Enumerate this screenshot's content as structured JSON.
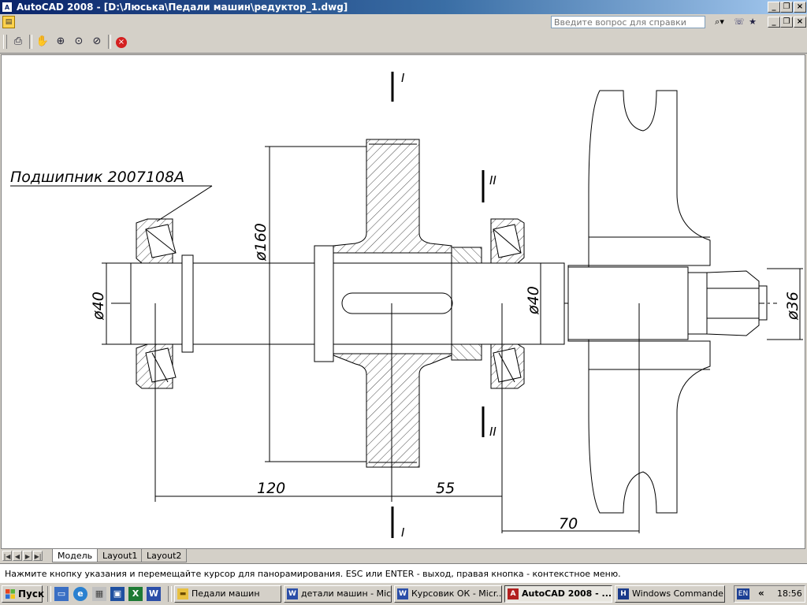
{
  "titlebar": {
    "app_title": "AutoCAD 2008 - [D:\\Люська\\Педали машин\\редуктор_1.dwg]",
    "app_icon": "autocad-icon"
  },
  "menubar": {
    "help_placeholder": "Введите вопрос для справки"
  },
  "toolbar": {
    "icons": [
      "print-icon",
      "pan-realtime-icon",
      "zoom-realtime-icon",
      "zoom-window-icon",
      "zoom-previous-icon",
      "close-icon"
    ]
  },
  "drawing": {
    "bearing_label": "Подшипник 2007108А",
    "section_marks": [
      "I",
      "II",
      "II",
      "I"
    ],
    "dimensions": {
      "d160": "ø160",
      "d40_left": "ø40",
      "d40_mid": "ø40",
      "d36": "ø36",
      "len120": "120",
      "len55": "55",
      "len70": "70"
    }
  },
  "layout_tabs": {
    "tabs": [
      "Модель",
      "Layout1",
      "Layout2"
    ],
    "active": "Модель"
  },
  "command_line": {
    "text": "Нажмите кнопку указания и перемещайте курсор для панорамирования. ESC или ENTER - выход, правая кнопка - контекстное меню."
  },
  "taskbar": {
    "start_label": "Пуск",
    "tasks": [
      {
        "label": "Педали машин",
        "icon": "folder-icon"
      },
      {
        "label": "детали машин - Mic...",
        "icon": "word-icon"
      },
      {
        "label": "Курсовик ОК - Micr...",
        "icon": "word-icon"
      },
      {
        "label": "AutoCAD 2008 - ...",
        "icon": "autocad-icon",
        "active": true
      },
      {
        "label": "Windows Commande...",
        "icon": "total-commander-icon"
      }
    ],
    "language": "EN",
    "clock": "18:56"
  }
}
